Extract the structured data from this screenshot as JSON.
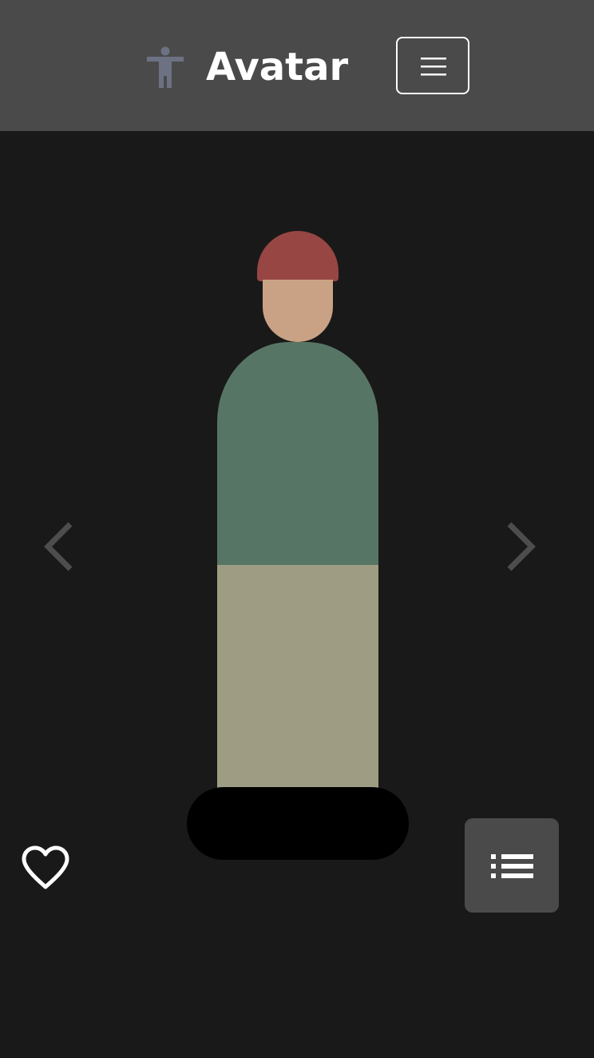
{
  "header": {
    "title": "Avatar",
    "logo_icon": "accessibility-person-icon",
    "menu_icon": "hamburger-menu-icon"
  },
  "avatar": {
    "hat_color": "#974643",
    "skin_color": "#c9a285",
    "shirt_color": "#577564",
    "pants_color": "#9e9d84",
    "shoes_color": "#000000"
  },
  "navigation": {
    "prev_icon": "chevron-left-icon",
    "next_icon": "chevron-right-icon"
  },
  "actions": {
    "favorite_icon": "heart-outline-icon",
    "list_icon": "list-icon"
  },
  "colors": {
    "header_bg": "#4a4a4a",
    "page_bg": "#191919",
    "arrow_color": "#4d4d4d",
    "logo_color": "#6c7282"
  }
}
